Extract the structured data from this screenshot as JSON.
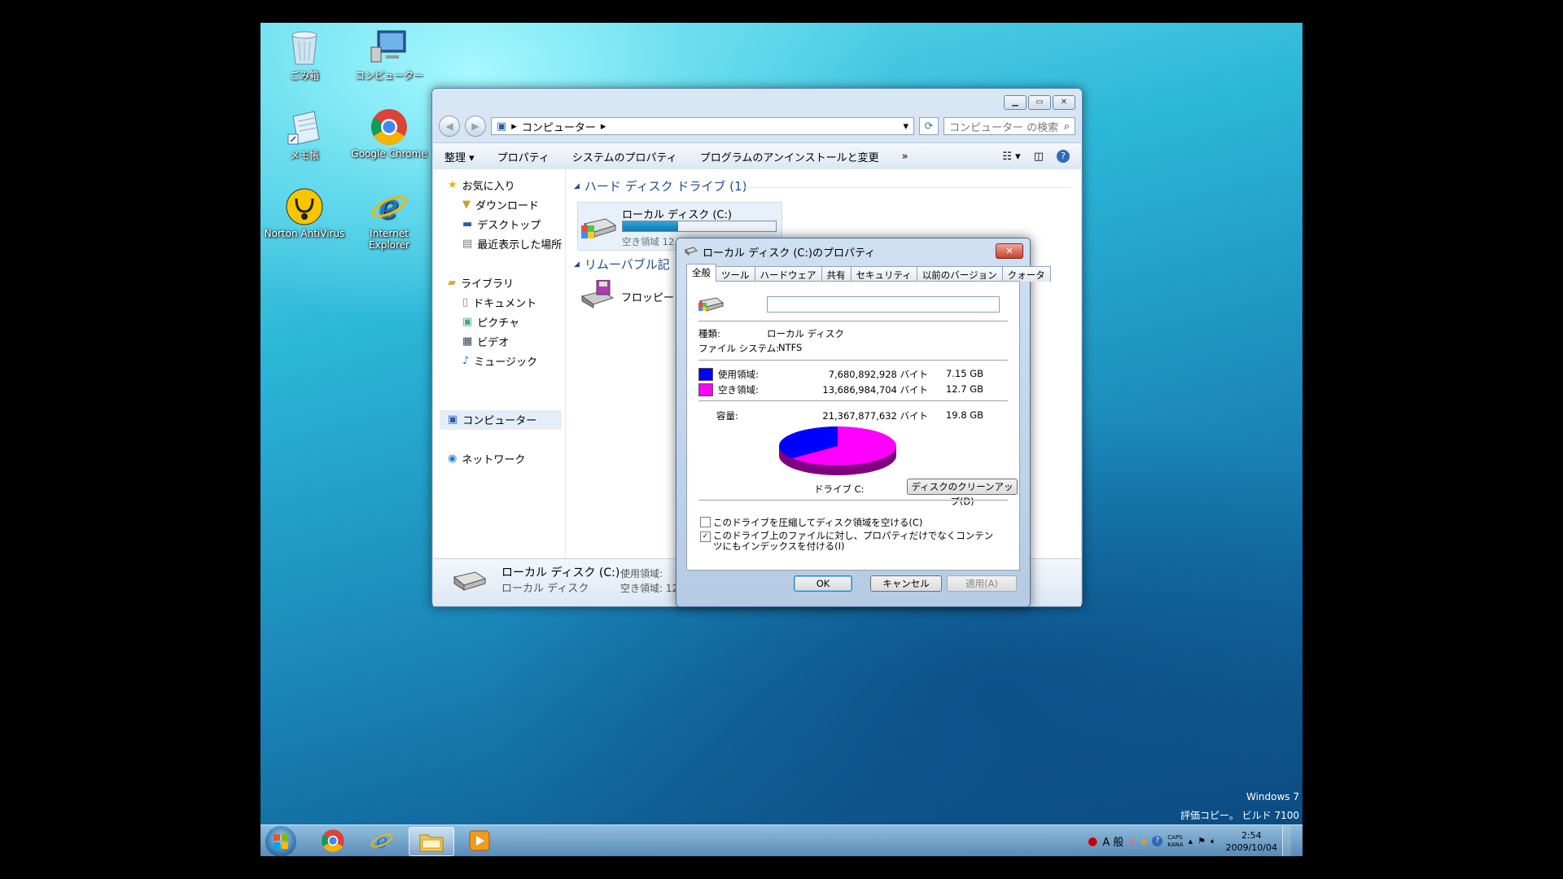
{
  "desktop": {
    "icons": [
      {
        "label": "ごみ箱",
        "icon": "recycle-bin-icon"
      },
      {
        "label": "コンピューター",
        "icon": "computer-icon"
      },
      {
        "label": "メモ帳",
        "icon": "notepad-icon"
      },
      {
        "label": "Google Chrome",
        "icon": "chrome-icon"
      },
      {
        "label": "Norton AntiVirus",
        "icon": "norton-icon"
      },
      {
        "label": "Internet Explorer",
        "icon": "ie-icon"
      }
    ],
    "watermark": {
      "line1": "Windows 7",
      "line2": "評価コピー。 ビルド 7100"
    }
  },
  "explorer": {
    "breadcrumb": "コンピューター",
    "search_placeholder": "コンピューター の検索",
    "toolbar": {
      "organize": "整理",
      "properties": "プロパティ",
      "system_properties": "システムのプロパティ",
      "uninstall": "プログラムのアンインストールと変更",
      "more": "»"
    },
    "nav": {
      "favorites": "お気に入り",
      "downloads": "ダウンロード",
      "desktop": "デスクトップ",
      "recent": "最近表示した場所",
      "libraries": "ライブラリ",
      "documents": "ドキュメント",
      "pictures": "ピクチャ",
      "videos": "ビデオ",
      "music": "ミュージック",
      "computer": "コンピューター",
      "network": "ネットワーク"
    },
    "groups": {
      "hdd": "ハード ディスク ドライブ (1)",
      "removable": "リムーバブル記"
    },
    "drive_c": {
      "name": "ローカル ディスク (C:)",
      "free_text": "空き領域 12.7 GB/19.8 GB",
      "used_fraction": 0.36
    },
    "floppy": "フロッピー",
    "status": {
      "name": "ローカル ディスク (C:)",
      "type": "ローカル ディスク",
      "used_label": "使用領域:",
      "free_label": "空き領域: 12"
    }
  },
  "dialog": {
    "title": "ローカル ディスク (C:)のプロパティ",
    "tabs": [
      "全般",
      "ツール",
      "ハードウェア",
      "共有",
      "セキュリティ",
      "以前のバージョン",
      "クォータ"
    ],
    "label_input": "",
    "type_label": "種類:",
    "type_value": "ローカル ディスク",
    "fs_label": "ファイル システム:",
    "fs_value": "NTFS",
    "used": {
      "label": "使用領域:",
      "bytes": "7,680,892,928 バイト",
      "gb": "7.15 GB",
      "color": "#0000ff"
    },
    "free": {
      "label": "空き領域:",
      "bytes": "13,686,984,704 バイト",
      "gb": "12.7 GB",
      "color": "#ff00ff"
    },
    "capacity": {
      "label": "容量:",
      "bytes": "21,367,877,632 バイト",
      "gb": "19.8 GB"
    },
    "drive_label": "ドライブ C:",
    "cleanup_button": "ディスクのクリーンアップ(D)",
    "compress_checkbox": "このドライブを圧縮してディスク領域を空ける(C)",
    "index_checkbox": "このドライブ上のファイルに対し、プロパティだけでなくコンテンツにもインデックスを付ける(I)",
    "ok": "OK",
    "cancel": "キャンセル",
    "apply": "適用(A)"
  },
  "taskbar": {
    "tray_ime": "A 般",
    "caps": "CAPS",
    "kana": "KANA",
    "time": "2:54",
    "date": "2009/10/04"
  }
}
